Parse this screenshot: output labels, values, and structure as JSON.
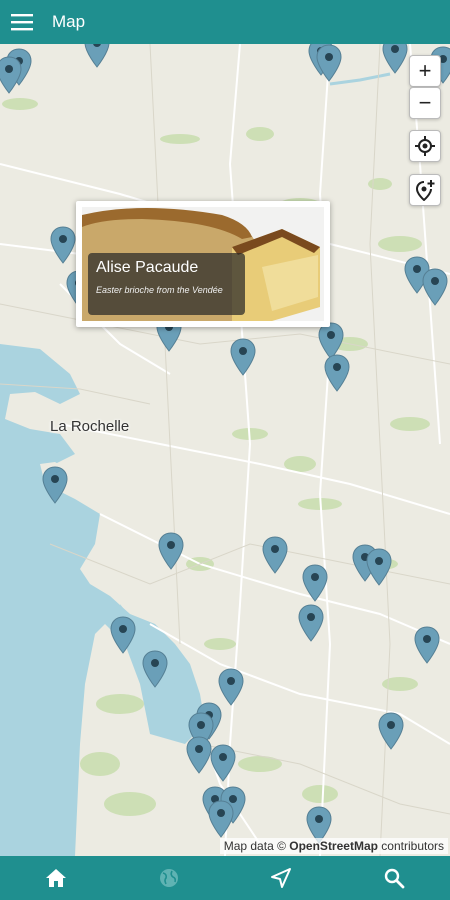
{
  "appbar": {
    "title": "Map"
  },
  "map": {
    "city_label": "La Rochelle",
    "attribution": {
      "prefix": "Map data ©",
      "source": "OpenStreetMap",
      "suffix": "contributors"
    }
  },
  "popup": {
    "title": "Alise Pacaude",
    "subtitle": "Easter brioche from the Vendée"
  },
  "controls": {
    "zoom_in": "+",
    "zoom_out": "−"
  },
  "icons": {
    "menu": "menu-icon",
    "zoom_in": "plus-icon",
    "zoom_out": "minus-icon",
    "locate": "locate-icon",
    "add_location": "add-location-icon",
    "home": "home-icon",
    "globe": "globe-icon",
    "navigate": "navigation-icon",
    "search": "search-icon"
  },
  "colors": {
    "bar": "#1f8f8f",
    "pin": "#6a9fb8",
    "sea": "#aad3df",
    "land": "#ecebe2"
  }
}
